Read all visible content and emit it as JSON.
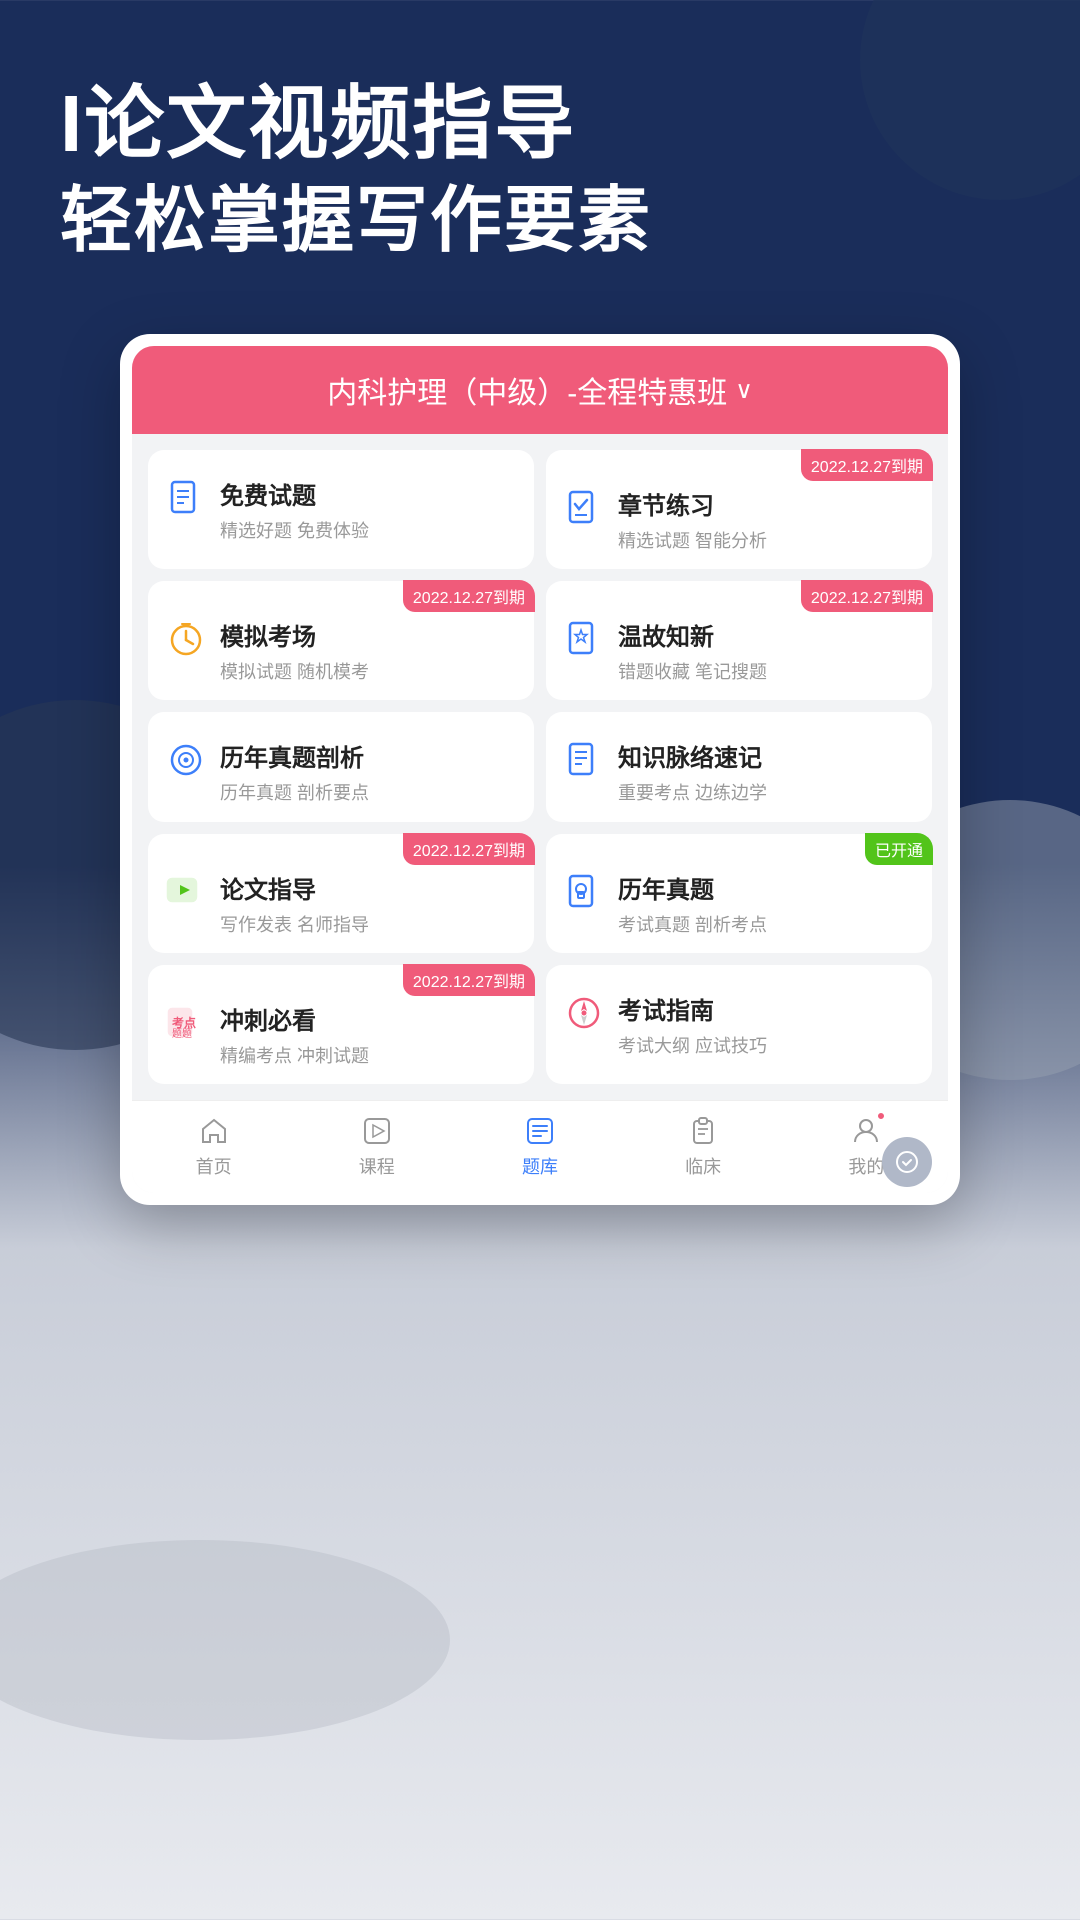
{
  "colors": {
    "primary_pink": "#f05b7a",
    "primary_blue": "#3d7ffa",
    "navy": "#1a2d5a",
    "gold": "#f5a623",
    "green": "#52c41a",
    "white": "#ffffff",
    "gray_text": "#999999",
    "dark_text": "#222222"
  },
  "header": {
    "line1": "I论文视频指导",
    "line2": "轻松掌握写作要素"
  },
  "app": {
    "course_title": "内科护理（中级）-全程特惠班",
    "course_arrow": "∨"
  },
  "cards": [
    {
      "id": "free-questions",
      "title": "免费试题",
      "subtitle": "精选好题 免费体验",
      "badge": null,
      "icon_type": "doc-blue"
    },
    {
      "id": "chapter-practice",
      "title": "章节练习",
      "subtitle": "精选试题 智能分析",
      "badge": "2022.12.27到期",
      "badge_color": "pink",
      "icon_type": "doc-blue"
    },
    {
      "id": "mock-exam",
      "title": "模拟考场",
      "subtitle": "模拟试题 随机模考",
      "badge": "2022.12.27到期",
      "badge_color": "pink",
      "icon_type": "clock-gold"
    },
    {
      "id": "review-new",
      "title": "温故知新",
      "subtitle": "错题收藏 笔记搜题",
      "badge": "2022.12.27到期",
      "badge_color": "pink",
      "icon_type": "doc-blue"
    },
    {
      "id": "past-analysis",
      "title": "历年真题剖析",
      "subtitle": "历年真题 剖析要点",
      "badge": null,
      "icon_type": "doc-circle-blue"
    },
    {
      "id": "knowledge-map",
      "title": "知识脉络速记",
      "subtitle": "重要考点 边练边学",
      "badge": null,
      "icon_type": "doc-blue"
    },
    {
      "id": "paper-guide",
      "title": "论文指导",
      "subtitle": "写作发表 名师指导",
      "badge": "2022.12.27到期",
      "badge_color": "pink",
      "icon_type": "video-green"
    },
    {
      "id": "past-exams",
      "title": "历年真题",
      "subtitle": "考试真题 剖析考点",
      "badge": "已开通",
      "badge_color": "green",
      "icon_type": "doc-lock-blue"
    },
    {
      "id": "sprint-must",
      "title": "冲刺必看",
      "subtitle": "精编考点 冲刺试题",
      "badge": "2022.12.27到期",
      "badge_color": "pink",
      "icon_type": "tag-red"
    },
    {
      "id": "exam-guide",
      "title": "考试指南",
      "subtitle": "考试大纲 应试技巧",
      "badge": null,
      "icon_type": "compass-pink"
    }
  ],
  "bottom_nav": [
    {
      "id": "home",
      "label": "首页",
      "icon": "home",
      "active": false
    },
    {
      "id": "course",
      "label": "课程",
      "icon": "play",
      "active": false
    },
    {
      "id": "question-bank",
      "label": "题库",
      "icon": "list",
      "active": true
    },
    {
      "id": "clinic",
      "label": "临床",
      "icon": "clipboard",
      "active": false
    },
    {
      "id": "mine",
      "label": "我的",
      "icon": "user",
      "active": false
    }
  ]
}
